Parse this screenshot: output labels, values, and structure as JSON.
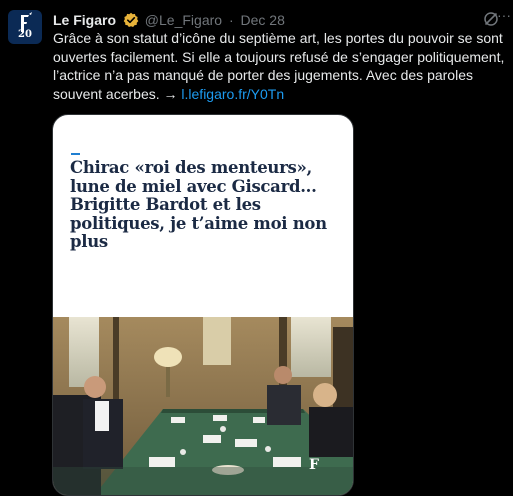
{
  "tweet": {
    "author_name": "Le Figaro",
    "handle": "@Le_Figaro",
    "separator": "·",
    "date": "Dec 28",
    "avatar_text": "20",
    "body": "Grâce à son statut d’icône du septième art, les portes du pouvoir se sont ouvertes facilement. Si elle a toujours refusé de s’engager politiquement, l’actrice n’a pas manqué de porter des jugements. Avec des paroles souvent acerbes. → ",
    "link": "l.lefigaro.fr/Y0Tn",
    "more_label": "···"
  },
  "card": {
    "headline": "Chirac «roi des menteurs», lune de miel avec Giscard... Brigitte Bardot et les politiques, je t’aime moi non plus",
    "photo_watermark": "F"
  },
  "colors": {
    "background": "#000000",
    "text": "#e7e9ea",
    "secondary": "#71767b",
    "link": "#1d9bf0",
    "verified_gold": "#e8b33a",
    "headline": "#1b2a44"
  },
  "icons": [
    "verified-gold-badge-icon",
    "grok-icon",
    "more-icon",
    "figaro-logo-icon"
  ]
}
